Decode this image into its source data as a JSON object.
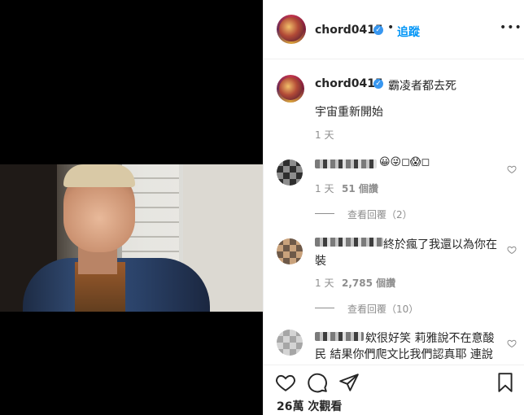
{
  "post": {
    "username": "chord0415",
    "follow_label": "追蹤",
    "more_label": "•••",
    "separator": "•",
    "caption_text": "霸凌者都去死",
    "caption_line2": "宇宙重新開始",
    "caption_time": "1 天"
  },
  "comments": [
    {
      "text": "😀😜◻😱◻",
      "time": "1 天",
      "likes": "51 個讚",
      "replies": "查看回覆（2）"
    },
    {
      "text_line1": "終於瘋了我還以為你在",
      "text_line2": "裝",
      "time": "1 天",
      "likes": "2,785 個讚",
      "replies": "查看回覆（10）"
    },
    {
      "text_line1": "欸很好笑 莉雅說不在意酸",
      "text_line2": "民 結果你們爬文比我們認真耶 連說"
    }
  ],
  "footer": {
    "views_count": "26萬",
    "views_label": "次觀看"
  },
  "icons": {
    "verified": "verified-badge-icon",
    "like": "heart-icon",
    "comment": "comment-icon",
    "share": "share-icon",
    "save": "bookmark-icon"
  },
  "colors": {
    "follow": "#0095f6",
    "verified": "#3897f0",
    "meta": "#8e8e8e"
  }
}
